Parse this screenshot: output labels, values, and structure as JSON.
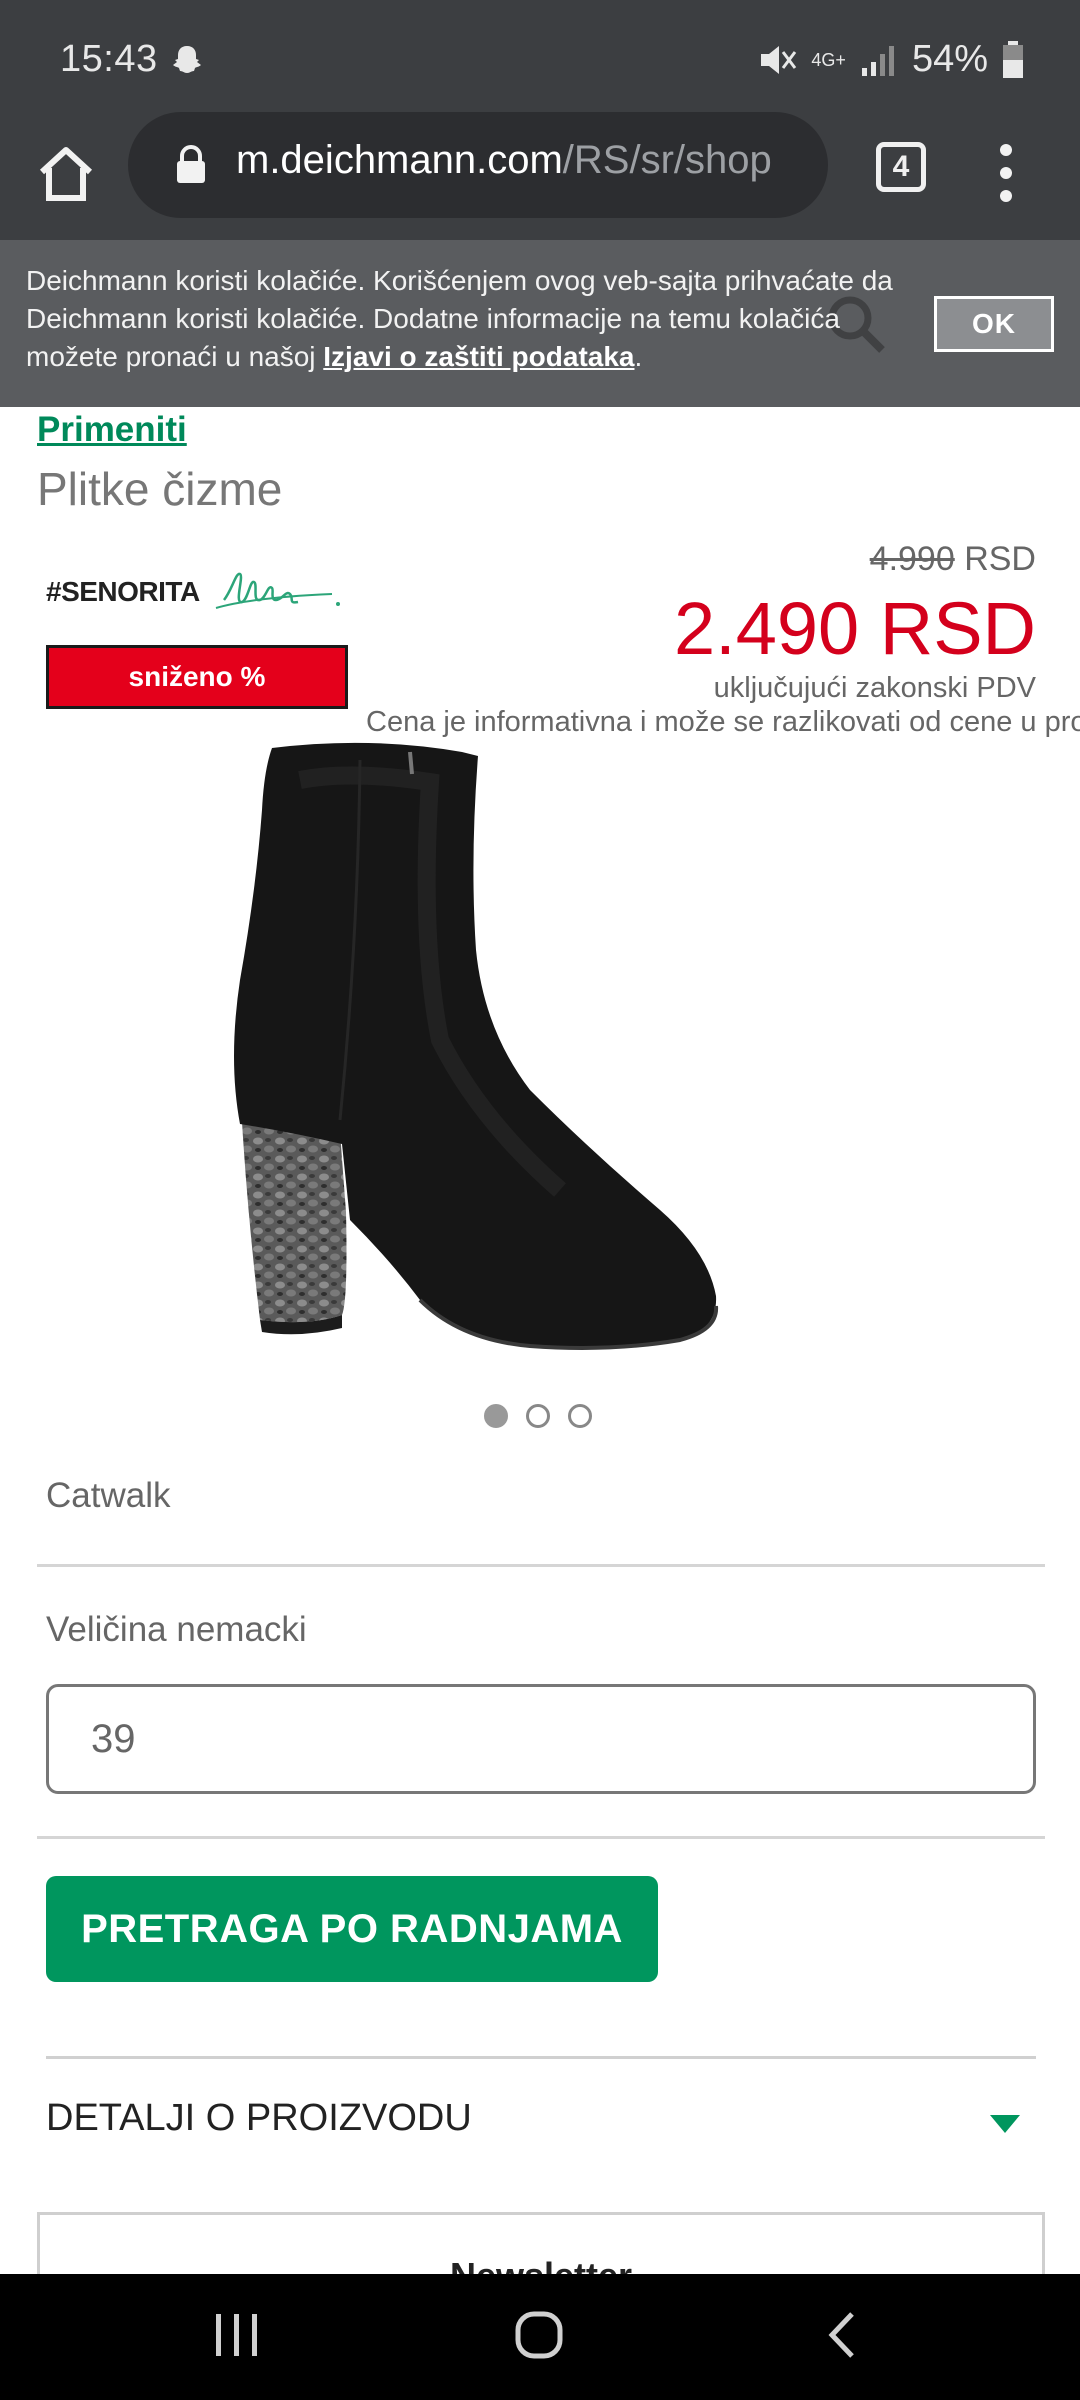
{
  "status_bar": {
    "time": "15:43",
    "network": "4G+",
    "battery": "54%"
  },
  "browser": {
    "url_host": "m.deichmann.com",
    "url_path": "/RS/sr/shop",
    "tab_count": "4"
  },
  "cookie_banner": {
    "text": "Deichmann koristi kolačiće. Korišćenjem ovog veb-sajta prihvaćate da Deichmann koristi kolačiće. Dodatne informacije na temu kolačića možete pronaći u našoj ",
    "link": "Izjavi o zaštiti podataka",
    "period": ".",
    "ok_label": "OK"
  },
  "product": {
    "apply_label": "Primeniti",
    "title": "Plitke čizme",
    "brand": "#SENORITA",
    "sale_badge": "sniženo %",
    "old_price": "4.990",
    "old_currency": "RSD",
    "new_price": "2.490 RSD",
    "vat_note": "uključujući zakonski PDV",
    "info_note": "Cena je informativna i može se razlikovati od cene u prodavnici",
    "image_count": 3,
    "active_image": 1,
    "color": "Catwalk",
    "size_label": "Veličina nemacki",
    "size_value": "39",
    "store_search_label": "PRETRAGA PO RADNJAMA",
    "details_label": "DETALJI O PROIZVODU",
    "newsletter_label": "Newsletter"
  },
  "colors": {
    "chrome": "#3c3e41",
    "accent_green": "#00965e",
    "price_red": "#d4001c",
    "sale_red": "#e4001b"
  }
}
